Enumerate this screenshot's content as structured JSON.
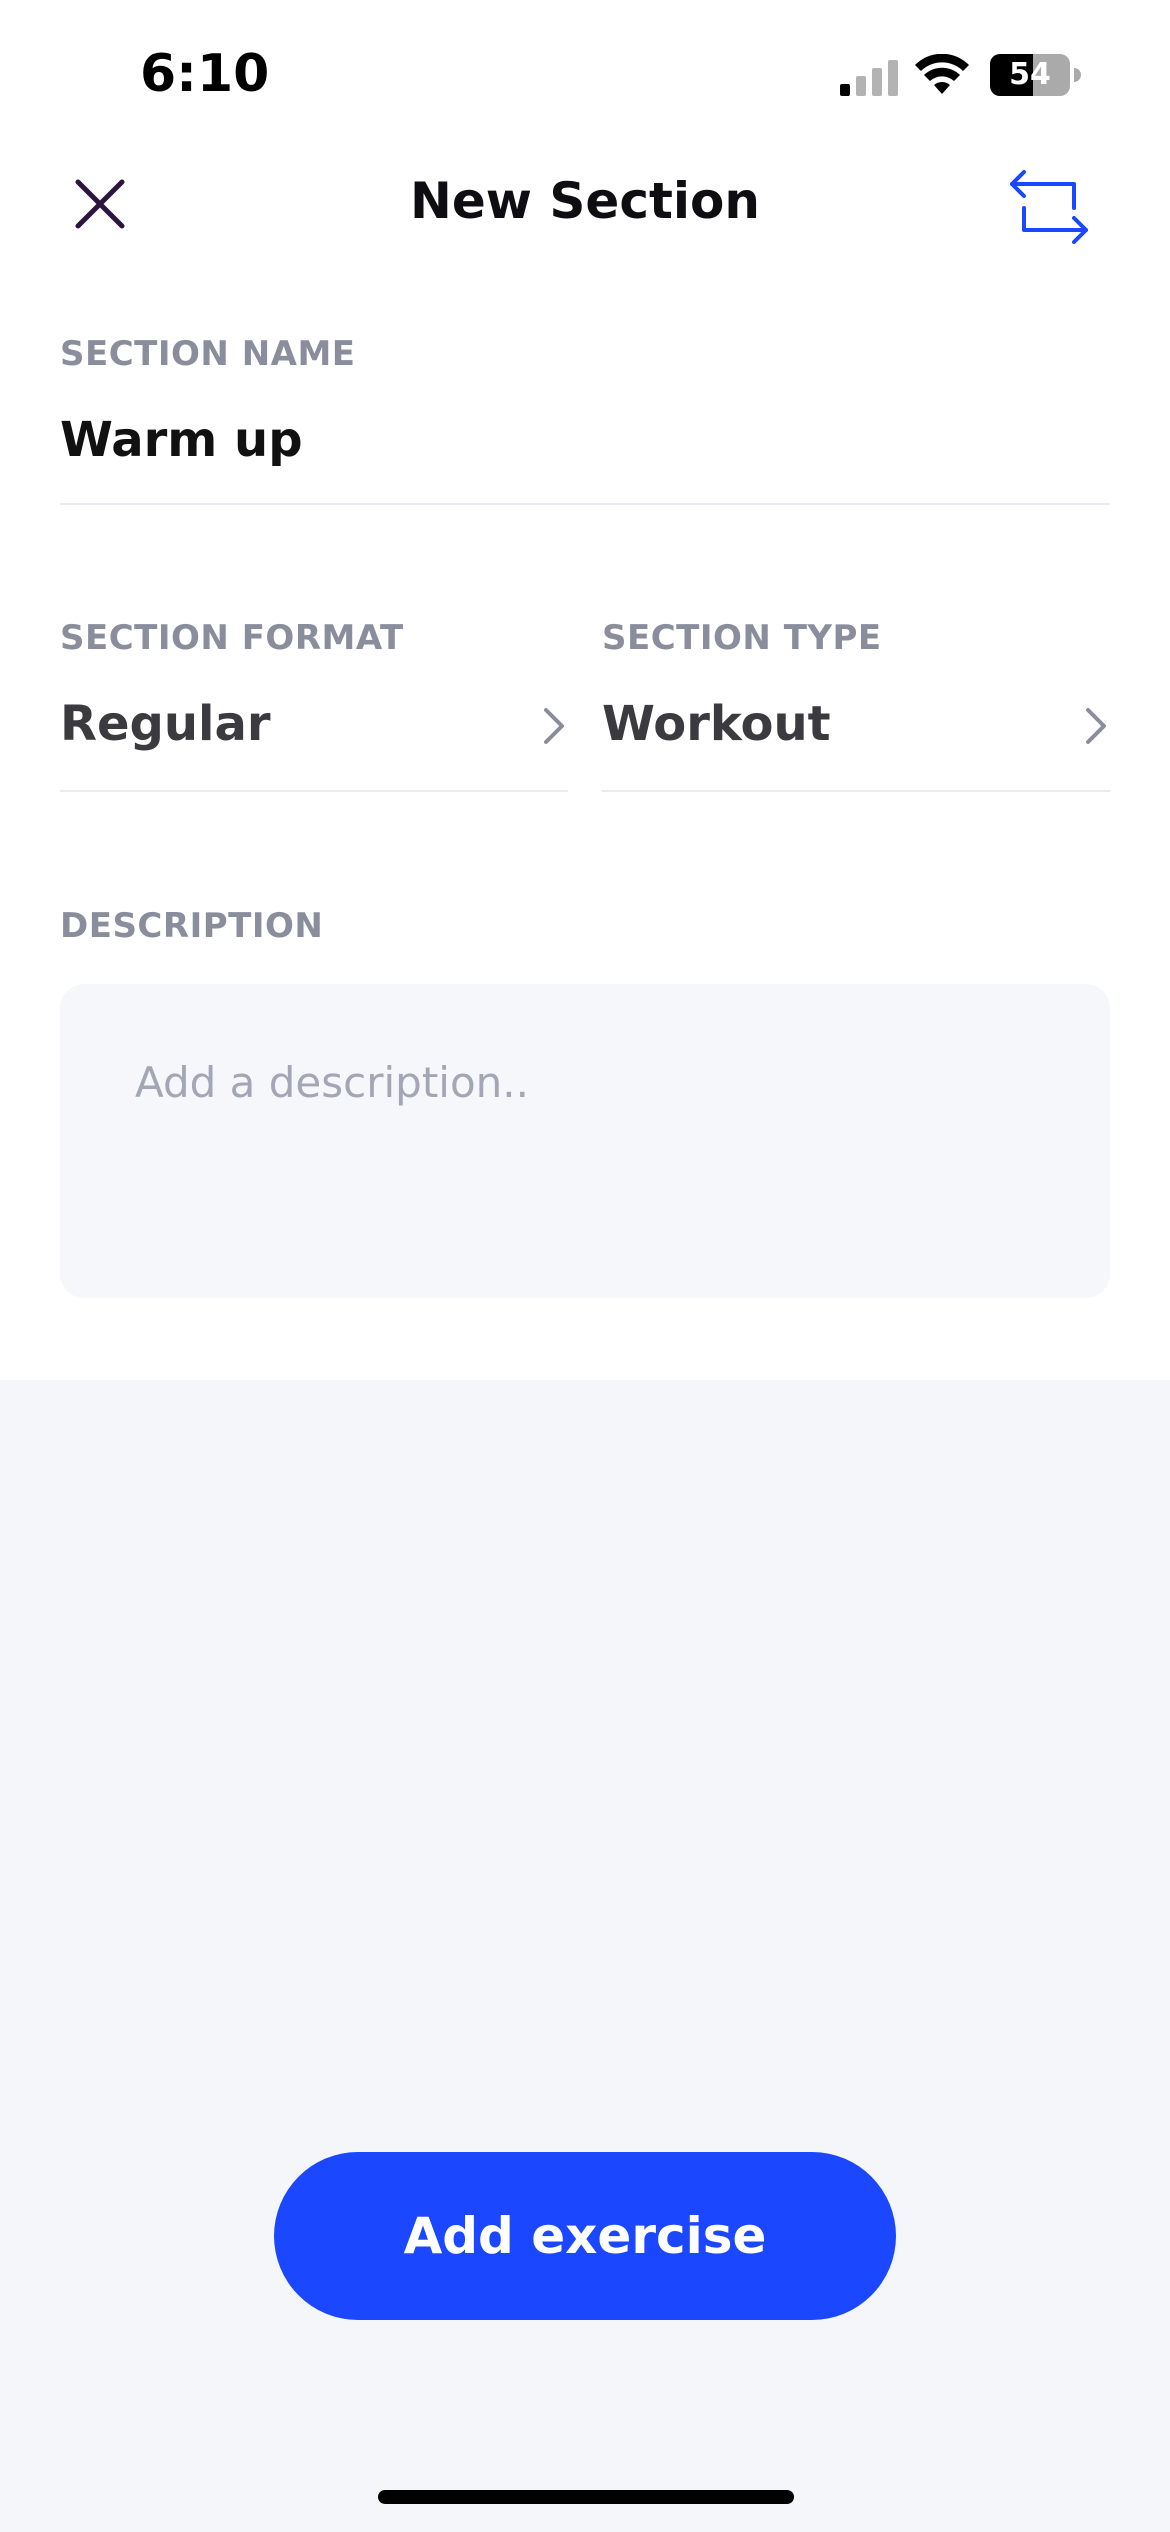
{
  "status_bar": {
    "time": "6:10",
    "battery": "54",
    "icons": [
      "signal-icon",
      "wifi-icon",
      "battery-icon"
    ]
  },
  "header": {
    "title": "New Section",
    "close_icon": "close-icon",
    "swap_icon": "swap-arrows-icon"
  },
  "section_name": {
    "label": "SECTION NAME",
    "value": "Warm up"
  },
  "section_format": {
    "label": "SECTION FORMAT",
    "value": "Regular"
  },
  "section_type": {
    "label": "SECTION TYPE",
    "value": "Workout"
  },
  "description": {
    "label": "DESCRIPTION",
    "placeholder": "Add a description.."
  },
  "actions": {
    "add_exercise_label": "Add exercise"
  },
  "colors": {
    "accent": "#1a47ff",
    "label": "#8a8d9c",
    "background": "#f5f6fa"
  }
}
